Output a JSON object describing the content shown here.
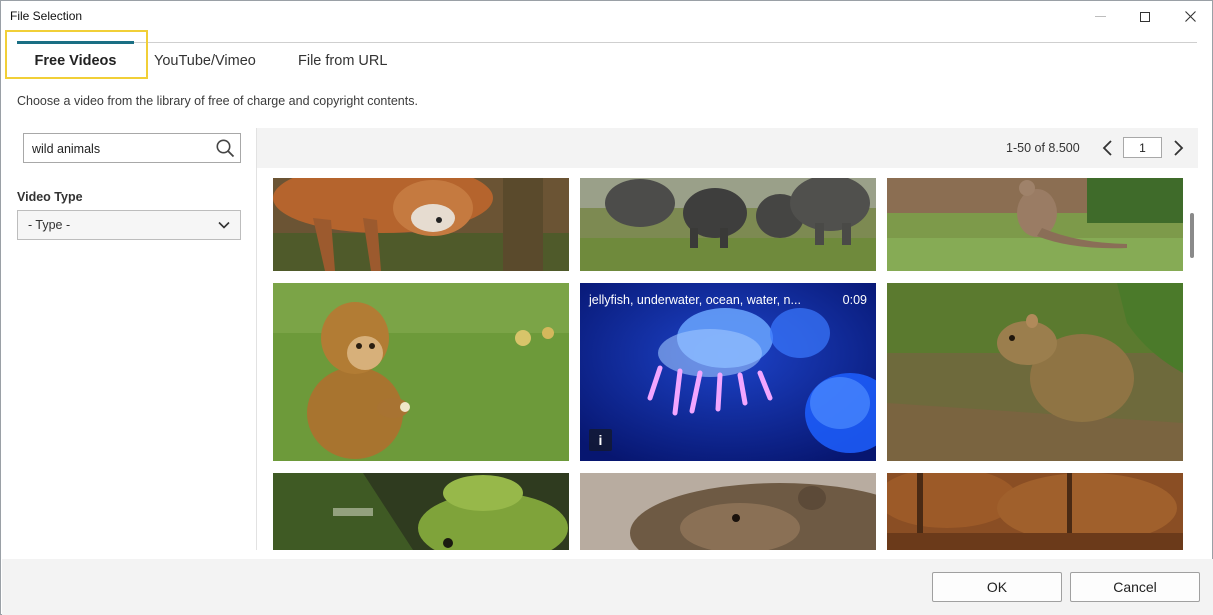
{
  "window": {
    "title": "File Selection",
    "controls": [
      "minimize-icon",
      "maximize-icon",
      "close-icon"
    ]
  },
  "tabs": [
    {
      "label": "Free Videos",
      "active": true
    },
    {
      "label": "YouTube/Vimeo",
      "active": false
    },
    {
      "label": "File from URL",
      "active": false
    }
  ],
  "description": "Choose a video from the library of free of charge and copyright contents.",
  "search": {
    "value": "wild animals",
    "icon": "search-icon"
  },
  "filters": {
    "video_type_label": "Video Type",
    "video_type_value": "- Type -"
  },
  "pagination": {
    "range_label": "1-50 of 8.500",
    "page": "1"
  },
  "videos": [
    {
      "subject": "fox"
    },
    {
      "subject": "elephants"
    },
    {
      "subject": "kangaroo"
    },
    {
      "subject": "monkey"
    },
    {
      "subject": "jellyfish",
      "overlay_title": "jellyfish, underwater, ocean, water, n...",
      "duration": "0:09",
      "info_label": "i"
    },
    {
      "subject": "agouti"
    },
    {
      "subject": "frog"
    },
    {
      "subject": "marmot"
    },
    {
      "subject": "autumn forest"
    }
  ],
  "footer": {
    "ok_label": "OK",
    "cancel_label": "Cancel"
  },
  "colors": {
    "tab_indicator": "#1a6f84",
    "highlight": "#f1cf37"
  }
}
